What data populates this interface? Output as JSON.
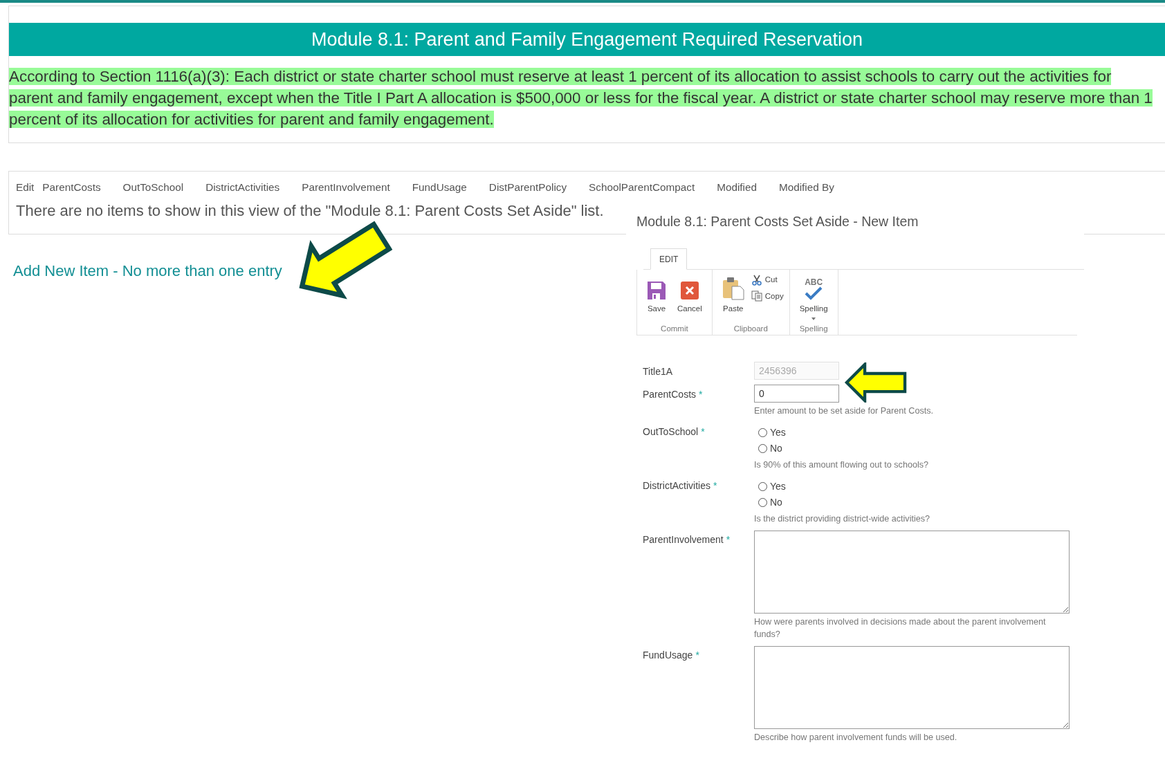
{
  "header": {
    "title": "Module 8.1: Parent and Family Engagement Required Reservation",
    "intro": "According to Section 1116(a)(3): Each district or state charter school must reserve at least 1 percent of its allocation to assist schools to carry out the activities for parent and family engagement, except when the Title I Part A allocation is $500,000 or less for the fiscal year. A district or state charter school may reserve more than 1 percent of its allocation for activities for parent and family engagement."
  },
  "list_view": {
    "columns": [
      "Edit",
      "ParentCosts",
      "OutToSchool",
      "DistrictActivities",
      "ParentInvolvement",
      "FundUsage",
      "DistParentPolicy",
      "SchoolParentCompact",
      "Modified",
      "Modified By"
    ],
    "empty_message": "There are no items to show in this view of the \"Module 8.1: Parent Costs Set Aside\" list."
  },
  "add_link": "Add New Item - No more than one entry",
  "dialog": {
    "title": "Module 8.1: Parent Costs Set Aside - New Item",
    "ribbon": {
      "tabs": [
        {
          "label": "EDIT",
          "selected": true
        }
      ],
      "groups": [
        {
          "name": "Commit",
          "buttons": [
            {
              "kind": "large",
              "label": "Save"
            },
            {
              "kind": "large",
              "label": "Cancel"
            }
          ]
        },
        {
          "name": "Clipboard",
          "buttons": [
            {
              "kind": "large",
              "label": "Paste"
            },
            {
              "kind": "small",
              "label": "Cut"
            },
            {
              "kind": "small",
              "label": "Copy"
            }
          ]
        },
        {
          "name": "Spelling",
          "buttons": [
            {
              "kind": "large",
              "icon_text": "ABC",
              "label": "Spelling",
              "dropdown": true
            }
          ]
        }
      ]
    },
    "fields": [
      {
        "kind": "text",
        "label": "Title1A",
        "value": "2456396",
        "disabled": true
      },
      {
        "kind": "text",
        "label": "ParentCosts",
        "required_mark": "*",
        "value": "0",
        "disabled": false,
        "hint": "Enter amount to be set aside for Parent Costs."
      },
      {
        "kind": "radio",
        "label": "OutToSchool",
        "required_mark": "*",
        "options": [
          {
            "label": "Yes",
            "selected": false
          },
          {
            "label": "No",
            "selected": false
          }
        ],
        "hint": "Is 90% of this amount flowing out to schools?"
      },
      {
        "kind": "radio",
        "label": "DistrictActivities",
        "required_mark": "*",
        "options": [
          {
            "label": "Yes",
            "selected": false
          },
          {
            "label": "No",
            "selected": false
          }
        ],
        "hint": "Is the district providing district-wide activities?"
      },
      {
        "kind": "textarea",
        "label": "ParentInvolvement",
        "required_mark": "*",
        "hint": "How were parents involved in decisions made about the parent involvement funds?"
      },
      {
        "kind": "textarea",
        "label": "FundUsage",
        "required_mark": "*",
        "hint": "Describe how parent involvement funds will be used."
      }
    ]
  }
}
